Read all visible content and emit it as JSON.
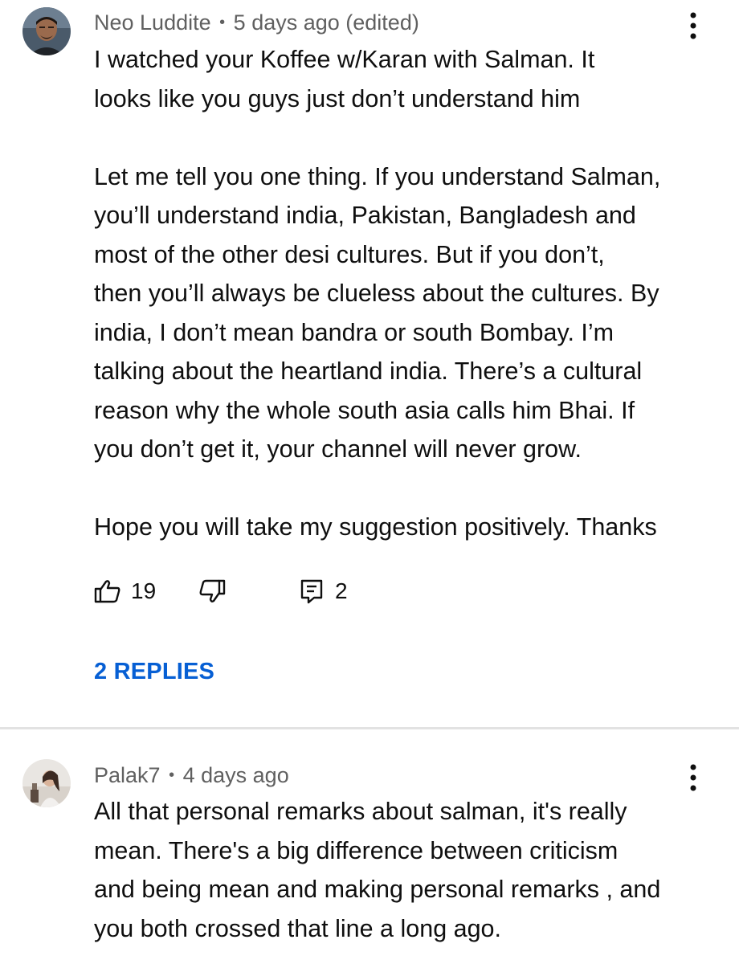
{
  "comments": [
    {
      "author": "Neo Luddite",
      "separator": "•",
      "timestamp": "5 days ago (edited)",
      "lines": [
        "I watched your Koffee w/Karan with Salman. It",
        "looks like you guys just don’t understand him",
        "",
        "Let me tell you one thing. If you understand Salman,",
        "you’ll understand india, Pakistan, Bangladesh and",
        "most of the other desi cultures. But if you don’t,",
        "then you’ll always be clueless about the cultures. By",
        "india, I don’t mean bandra or south Bombay. I’m",
        "talking about the heartland india. There’s a cultural",
        "reason why the whole south asia calls him Bhai. If",
        "you don’t get it, your channel will never grow.",
        "",
        "Hope you will take my suggestion positively. Thanks"
      ],
      "likes": "19",
      "replies_count": "2",
      "replies_link": "2 REPLIES",
      "avatar_icon": "user-avatar-photo",
      "more_icon": "vertical-dots-icon"
    },
    {
      "author": "Palak7",
      "separator": "•",
      "timestamp": "4 days ago",
      "lines": [
        "All that personal remarks about salman, it's really",
        "mean. There's a big difference between criticism",
        "and being mean and making personal remarks , and",
        "you both crossed that line a long ago."
      ],
      "avatar_icon": "user-avatar-photo",
      "more_icon": "vertical-dots-icon"
    }
  ],
  "colors": {
    "text": "#0f0f0f",
    "meta": "#606060",
    "link": "#065fd4",
    "divider": "#e2e2e2"
  }
}
